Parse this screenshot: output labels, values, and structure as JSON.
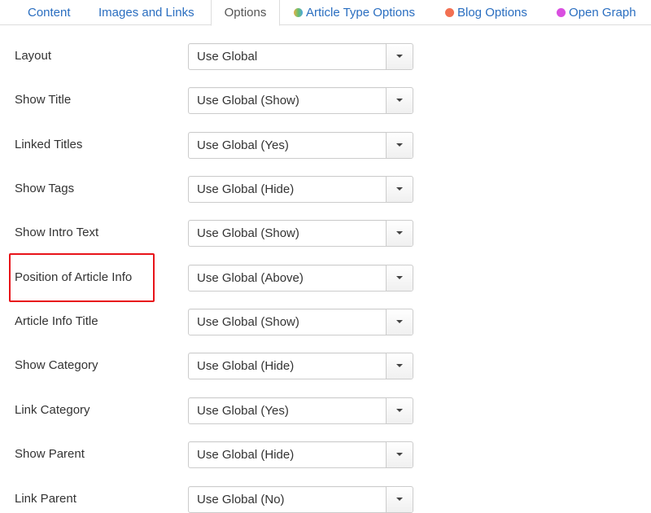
{
  "tabs": [
    {
      "label": "Content",
      "dot_color": null,
      "active": false
    },
    {
      "label": "Images and Links",
      "dot_color": null,
      "active": false
    },
    {
      "label": "Options",
      "dot_color": null,
      "active": true
    },
    {
      "label": "Article Type Options",
      "dot_color": "#6cbf6a",
      "active": false
    },
    {
      "label": "Blog Options",
      "dot_color": "#f27052",
      "active": false
    },
    {
      "label": "Open Graph",
      "dot_color": "#d94fe0",
      "active": false
    }
  ],
  "fields": [
    {
      "label": "Layout",
      "value": "Use Global"
    },
    {
      "label": "Show Title",
      "value": "Use Global (Show)"
    },
    {
      "label": "Linked Titles",
      "value": "Use Global (Yes)"
    },
    {
      "label": "Show Tags",
      "value": "Use Global (Hide)"
    },
    {
      "label": "Show Intro Text",
      "value": "Use Global (Show)"
    },
    {
      "label": "Position of Article Info",
      "value": "Use Global (Above)"
    },
    {
      "label": "Article Info Title",
      "value": "Use Global (Show)"
    },
    {
      "label": "Show Category",
      "value": "Use Global (Hide)"
    },
    {
      "label": "Link Category",
      "value": "Use Global (Yes)"
    },
    {
      "label": "Show Parent",
      "value": "Use Global (Hide)"
    },
    {
      "label": "Link Parent",
      "value": "Use Global (No)"
    }
  ],
  "highlight": {
    "field": "Position of Article Info",
    "color": "#e8141a"
  },
  "colors": {
    "link": "#2a6ec0",
    "active_tab_text": "#555555",
    "border": "#cccccc"
  }
}
